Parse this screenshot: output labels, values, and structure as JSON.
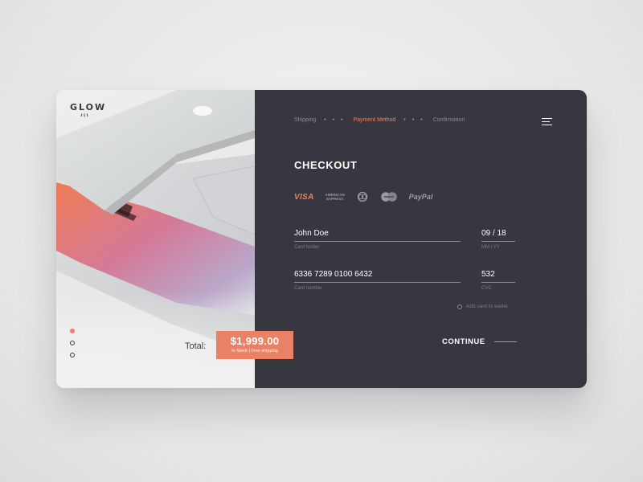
{
  "brand": {
    "logo": "GLOW"
  },
  "steps": [
    {
      "label": "Shipping",
      "active": false
    },
    {
      "label": "Payment Method",
      "active": true
    },
    {
      "label": "Confirmation",
      "active": false
    }
  ],
  "step_separator": "• • •",
  "checkout": {
    "title": "CHECKOUT",
    "card_brands": {
      "visa": "VISA",
      "amex_line1": "AMERICAN",
      "amex_line2": "EXPRESS",
      "paypal": "PayPal"
    },
    "card_holder": {
      "value": "John Doe",
      "label": "Card holder"
    },
    "expiry": {
      "value": "09 / 18",
      "label": "MM / YY"
    },
    "card_number": {
      "value": "6336 7289 0100 6432",
      "label": "Card number"
    },
    "cvc": {
      "value": "532",
      "label": "CVC"
    },
    "wallet_label": "Add card to wallet",
    "continue_label": "CONTINUE"
  },
  "order": {
    "total_label": "Total:",
    "price": "$1,999.00",
    "stock_note": "In Stock | Free shipping"
  },
  "slider": {
    "count": 3,
    "active_index": 0
  },
  "colors": {
    "accent": "#ea8064",
    "panel_dark": "#37373f",
    "panel_light": "#e8e8e8"
  }
}
